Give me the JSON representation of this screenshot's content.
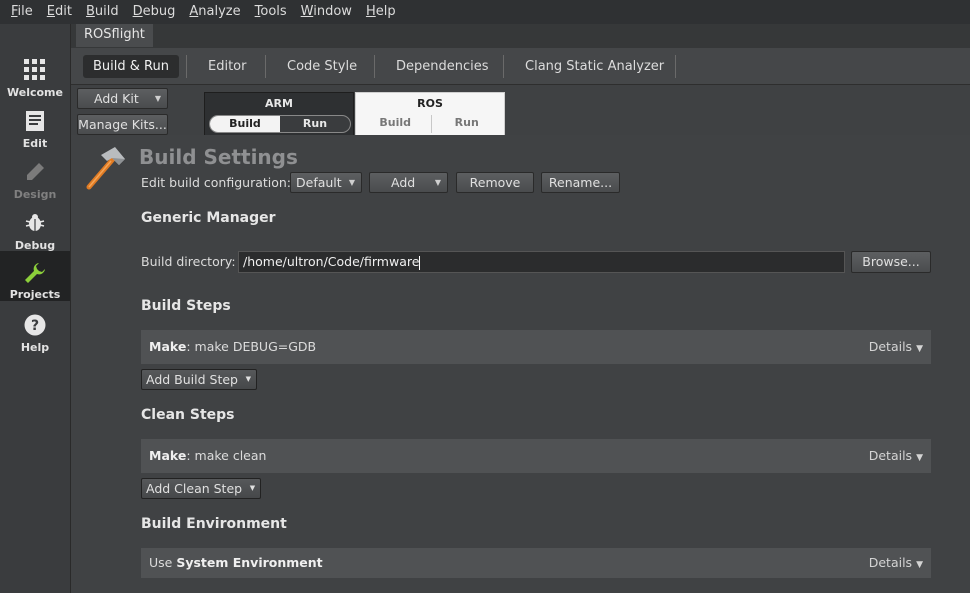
{
  "menu": [
    {
      "u": "F",
      "rest": "ile"
    },
    {
      "u": "E",
      "rest": "dit"
    },
    {
      "u": "B",
      "rest": "uild"
    },
    {
      "u": "D",
      "rest": "ebug"
    },
    {
      "u": "A",
      "rest": "nalyze"
    },
    {
      "u": "T",
      "rest": "ools"
    },
    {
      "u": "W",
      "rest": "indow"
    },
    {
      "u": "H",
      "rest": "elp"
    }
  ],
  "modes": {
    "welcome": "Welcome",
    "edit": "Edit",
    "design": "Design",
    "debug": "Debug",
    "projects": "Projects",
    "help": "Help"
  },
  "project_tab": "ROSflight",
  "settings_tabs": {
    "build_run": "Build & Run",
    "editor": "Editor",
    "code_style": "Code Style",
    "dependencies": "Dependencies",
    "clang": "Clang Static Analyzer"
  },
  "kits": {
    "add_kit": "Add Kit",
    "manage_kits": "Manage Kits...",
    "arm": {
      "name": "ARM",
      "build": "Build",
      "run": "Run"
    },
    "ros": {
      "name": "ROS",
      "build": "Build",
      "run": "Run"
    }
  },
  "build_settings": {
    "title": "Build Settings",
    "edit_config_label": "Edit build configuration:",
    "config_value": "Default",
    "add": "Add",
    "remove": "Remove",
    "rename": "Rename..."
  },
  "generic_manager": {
    "title": "Generic Manager",
    "build_dir_label": "Build directory:",
    "build_dir_value": "/home/ultron/Code/firmware",
    "browse": "Browse..."
  },
  "build_steps": {
    "title": "Build Steps",
    "step_name": "Make",
    "step_cmd": ": make DEBUG=GDB",
    "details": "Details",
    "add_button": "Add Build Step"
  },
  "clean_steps": {
    "title": "Clean Steps",
    "step_name": "Make",
    "step_cmd": ": make clean",
    "details": "Details",
    "add_button": "Add Clean Step"
  },
  "build_environment": {
    "title": "Build Environment",
    "prefix": "Use ",
    "name": "System Environment",
    "details": "Details"
  },
  "colors": {
    "accent_projects": "#8ccf3a",
    "hammer_handle": "#e07b24"
  }
}
